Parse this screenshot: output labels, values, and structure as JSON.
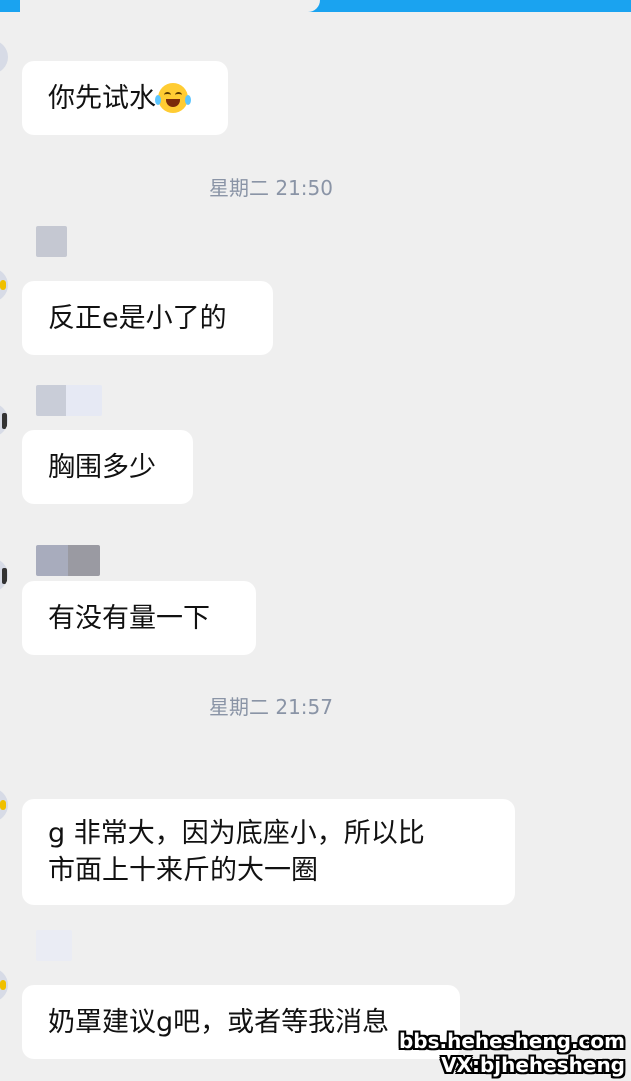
{
  "messages": [
    {
      "text": "你先试水",
      "emoji": "face-with-tears-of-joy"
    },
    {
      "text": "反正e是小了的"
    },
    {
      "text": "胸围多少"
    },
    {
      "text": "有没有量一下"
    },
    {
      "lines": [
        "g 非常大，因为底座小，所以比",
        "市面上十来斤的大一圈"
      ]
    },
    {
      "text": "奶罩建议g吧，或者等我消息"
    }
  ],
  "timestamps": [
    "星期二 21:50",
    "星期二 21:57"
  ],
  "watermark": {
    "line1": "bbs.hehesheng.com",
    "line2": "VX:bjhehesheng"
  },
  "colors": {
    "top_bar": "#1aa3f0",
    "background": "#efefef",
    "bubble": "#ffffff",
    "timestamp": "#8a94a6"
  }
}
